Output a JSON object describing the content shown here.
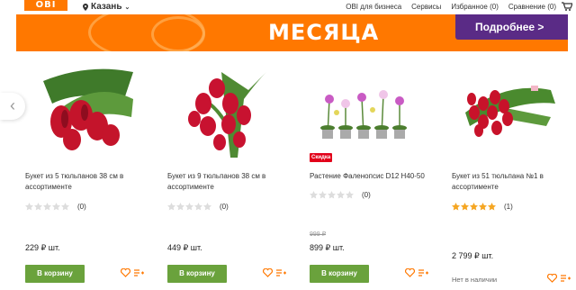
{
  "header": {
    "logo": "OBI",
    "city": "Казань",
    "links": [
      "OBI для бизнеса",
      "Сервисы",
      "Избранное (0)",
      "Сравнение (0)"
    ]
  },
  "banner": {
    "headline": "МЕСЯЦА",
    "button": "Подробнее >"
  },
  "colors": {
    "accent": "#ff7800",
    "brand_purple": "#5a2b86",
    "button_green": "#6aa23c",
    "sale_red": "#e2001a",
    "star_gold": "#f5a623"
  },
  "products": [
    {
      "title": "Букет из 5 тюльпанов 38 см в ассортименте",
      "rating": 0,
      "reviews": "(0)",
      "old_price": "",
      "price": "229 ₽ шт.",
      "action": "В корзину",
      "badge": ""
    },
    {
      "title": "Букет из 9 тюльпанов 38 см в ассортименте",
      "rating": 0,
      "reviews": "(0)",
      "old_price": "",
      "price": "449 ₽ шт.",
      "action": "В корзину",
      "badge": ""
    },
    {
      "title": "Растение Фаленопсис D12 H40-50",
      "rating": 0,
      "reviews": "(0)",
      "old_price": "999 ₽",
      "price": "899 ₽ шт.",
      "action": "В корзину",
      "badge": "Скидка"
    },
    {
      "title": "Букет из 51 тюльпана №1 в ассортименте",
      "rating": 5,
      "reviews": "(1)",
      "old_price": "",
      "price": "2 799 ₽ шт.",
      "action": "Нет в наличии",
      "badge": ""
    }
  ]
}
